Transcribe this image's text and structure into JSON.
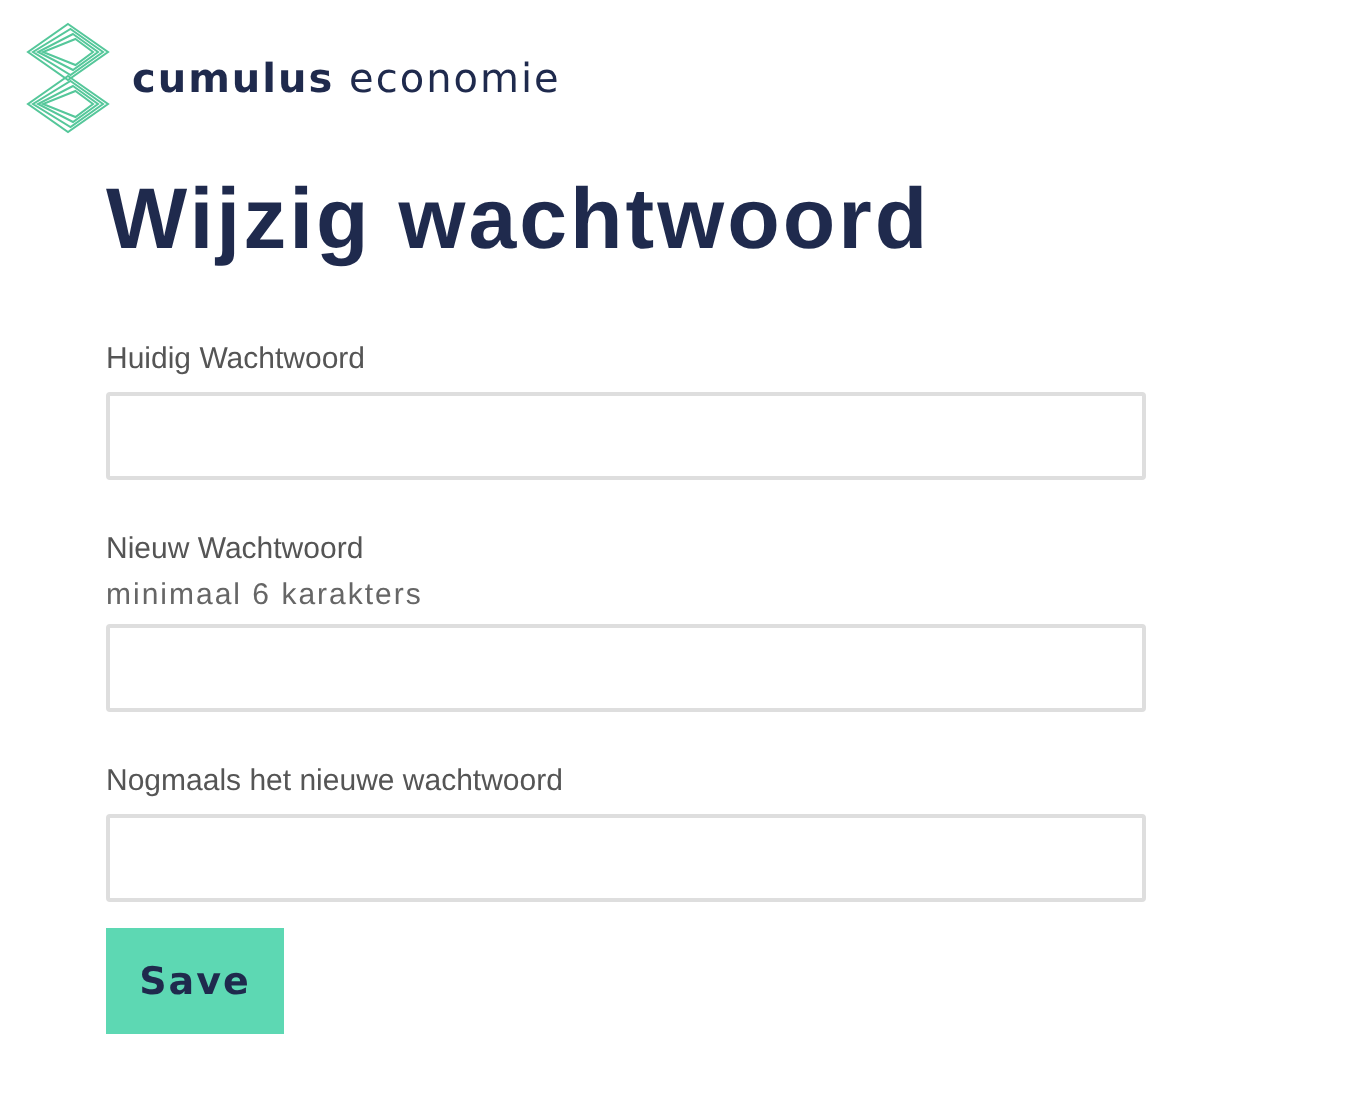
{
  "logo": {
    "text": "**cumulus** economie"
  },
  "title": "Wijzig wachtwoord",
  "fields": [
    {
      "label": "Huidig Wachtwoord"
    },
    {
      "label": "Nieuw Wachtwoord",
      "hint": "minimaal 6 karakters"
    },
    {
      "label": "Nogmaals het nieuwe wachtwoord"
    }
  ],
  "button": "Save"
}
